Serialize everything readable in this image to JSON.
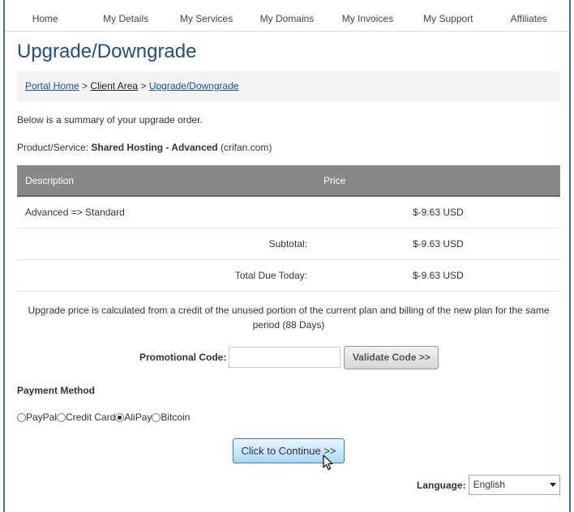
{
  "nav": {
    "items": [
      "Home",
      "My Details",
      "My Services",
      "My Domains",
      "My Invoices",
      "My Support",
      "Affiliates"
    ]
  },
  "page": {
    "title": "Upgrade/Downgrade"
  },
  "breadcrumb": {
    "portal_home": "Portal Home",
    "sep": ">",
    "client_area": "Client Area",
    "current": "Upgrade/Downgrade"
  },
  "summary_text": "Below is a summary of your upgrade order.",
  "product": {
    "label": "Product/Service:",
    "name": "Shared Hosting - Advanced",
    "domain": "(crifan.com)"
  },
  "order_table": {
    "headers": {
      "description": "Description",
      "price": "Price"
    },
    "item": {
      "description": "Advanced => Standard",
      "price": "$-9.63 USD"
    },
    "subtotal": {
      "label": "Subtotal:",
      "value": "$-9.63 USD"
    },
    "total": {
      "label": "Total Due Today:",
      "value": "$-9.63 USD"
    }
  },
  "note": "Upgrade price is calculated from a credit of the unused portion of the current plan and billing of the new plan for the same period (88 Days)",
  "promo": {
    "label": "Promotional Code:",
    "value": "",
    "validate_label": "Validate Code >>"
  },
  "payment": {
    "title": "Payment Method",
    "options": [
      "PayPal",
      "Credit Card",
      "AliPay",
      "Bitcoin"
    ],
    "selected": "AliPay"
  },
  "continue_label": "Click to Continue >>",
  "language": {
    "label": "Language:",
    "selected": "English"
  },
  "icons": {
    "cursor": "mouse-pointer-icon",
    "dropdown": "chevron-down-icon"
  }
}
